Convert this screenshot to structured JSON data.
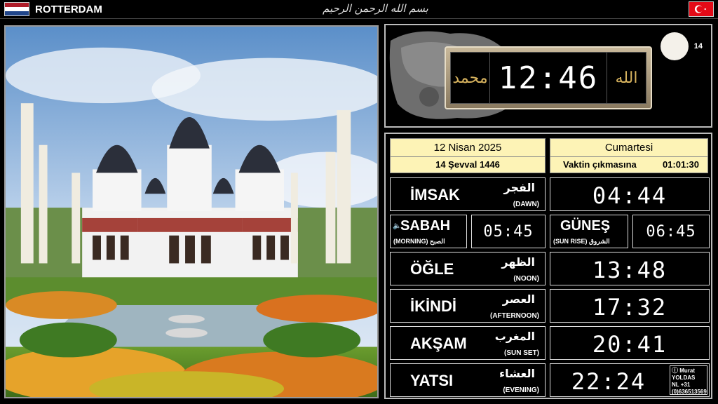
{
  "header": {
    "city": "ROTTERDAM",
    "basmala": "بسم الله الرحمن الرحيم",
    "flag_left": "netherlands-flag",
    "flag_right": "turkey-flag"
  },
  "photo": {
    "subject": "mosque-photo"
  },
  "clock": {
    "time": "12:46",
    "callig_left": "محمد",
    "callig_right": "الله",
    "moon_day": "14"
  },
  "date": {
    "gregorian": "12 Nisan 2025",
    "hijri": "14 Şevval 1446",
    "weekday": "Cumartesi",
    "remaining_label": "Vaktin çıkmasına",
    "remaining_value": "01:01:30"
  },
  "prayers": {
    "imsak": {
      "name": "İMSAK",
      "arabic": "الفجر",
      "english": "(DAWN)",
      "time": "04:44"
    },
    "sabah": {
      "name": "SABAH",
      "arabic": "الصبح",
      "english": "(MORNING)",
      "time": "05:45"
    },
    "gunes": {
      "name": "GÜNEŞ",
      "arabic": "الشروق",
      "english": "(SUN RISE)",
      "time": "06:45"
    },
    "ogle": {
      "name": "ÖĞLE",
      "arabic": "الظهر",
      "english": "(NOON)",
      "time": "13:48"
    },
    "ikindi": {
      "name": "İKİNDİ",
      "arabic": "العصر",
      "english": "(AFTERNOON)",
      "time": "17:32"
    },
    "aksam": {
      "name": "AKŞAM",
      "arabic": "المغرب",
      "english": "(SUN SET)",
      "time": "20:41"
    },
    "yatsi": {
      "name": "YATSI",
      "arabic": "العشاء",
      "english": "(EVENING)",
      "time": "22:24"
    }
  },
  "contact": {
    "line1": "Murat",
    "line2": "YOLDAS",
    "line3": "NL +31",
    "line4": "(0)636513569"
  },
  "colors": {
    "date_bg": "#fdf3b6",
    "background": "#000000",
    "flag_red_tr": "#e30a17"
  }
}
